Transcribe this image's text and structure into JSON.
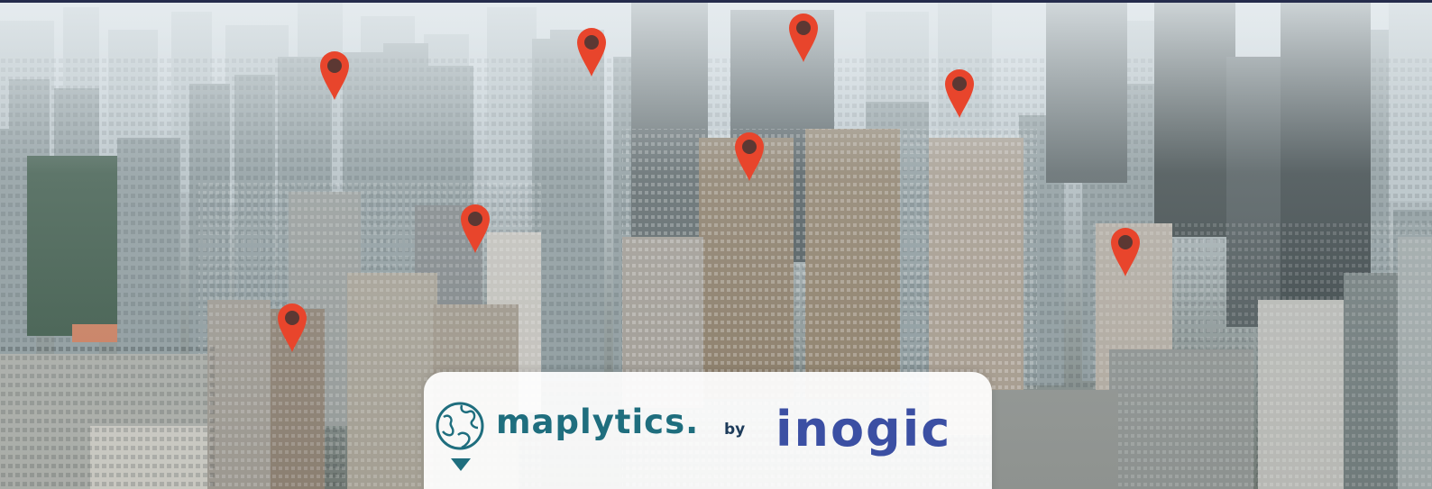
{
  "banner": {
    "product_name": "maplytics.",
    "by_text": "by",
    "company_name": "inogic",
    "colors": {
      "maplytics_teal": "#1f6e7e",
      "inogic_blue": "#3b4fa3",
      "pin_red": "#e8452c",
      "top_border": "#252c4c"
    },
    "icons": {
      "product_logo": "globe-icon",
      "pins": "map-pin-icon",
      "down_marker": "triangle-down-icon"
    }
  }
}
